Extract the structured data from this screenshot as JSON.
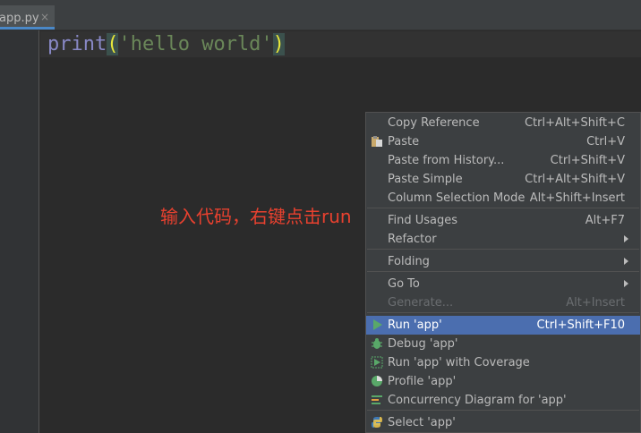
{
  "editor": {
    "tab_label": "app.py",
    "tab_close": "×",
    "code": {
      "func": "print",
      "open_paren": "(",
      "string": "'hello world'",
      "close_paren": ")"
    }
  },
  "annotation": "输入代码，右键点击run",
  "menu": {
    "items": [
      {
        "label": "Copy Reference",
        "shortcut": "Ctrl+Alt+Shift+C"
      },
      {
        "label": "Paste",
        "shortcut": "Ctrl+V",
        "icon": "paste-icon"
      },
      {
        "label": "Paste from History...",
        "shortcut": "Ctrl+Shift+V"
      },
      {
        "label": "Paste Simple",
        "shortcut": "Ctrl+Alt+Shift+V"
      },
      {
        "label": "Column Selection Mode",
        "shortcut": "Alt+Shift+Insert"
      },
      {
        "label": "Find Usages",
        "shortcut": "Alt+F7"
      },
      {
        "label": "Refactor",
        "submenu": true
      },
      {
        "label": "Folding",
        "submenu": true
      },
      {
        "label": "Go To",
        "submenu": true
      },
      {
        "label": "Generate...",
        "shortcut": "Alt+Insert",
        "disabled": true
      },
      {
        "label": "Run 'app'",
        "shortcut": "Ctrl+Shift+F10",
        "icon": "run-icon",
        "selected": true
      },
      {
        "label": "Debug 'app'",
        "icon": "debug-icon"
      },
      {
        "label": "Run 'app' with Coverage",
        "icon": "coverage-icon"
      },
      {
        "label": "Profile 'app'",
        "icon": "profile-icon"
      },
      {
        "label": "Concurrency Diagram for 'app'",
        "icon": "concurrency-icon"
      },
      {
        "label": "Select 'app'",
        "icon": "python-icon"
      }
    ]
  },
  "colors": {
    "editor_bg": "#2b2b2b",
    "menu_bg": "#3c3f41",
    "selection": "#4b6eaf",
    "annotation": "#e8412f",
    "string": "#6a8759",
    "paren_highlight": "#e8e83a"
  }
}
